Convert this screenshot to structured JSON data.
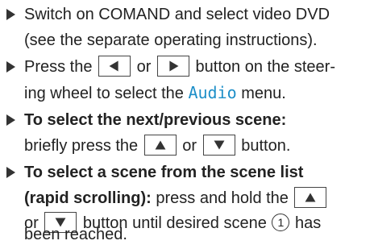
{
  "bullets": [
    {
      "lines": [
        "Switch on COMAND and select video DVD",
        "(see the separate operating instructions)."
      ]
    },
    {
      "l1_a": "Press the",
      "l1_b": "or",
      "l1_c": "button on the steer-",
      "l2_a": "ing wheel to select the",
      "l2_menu": "Audio",
      "l2_b": "menu."
    },
    {
      "l1_bold": "To select the next/previous scene:",
      "l2_a": "briefly press the",
      "l2_b": "or",
      "l2_c": "button."
    },
    {
      "l1_bold": "To select a scene from the scene list",
      "l2_bold": "(rapid scrolling):",
      "l2_a": "press and hold the",
      "l3_a": "or",
      "l3_b": "button until desired scene",
      "l3_marker": "1",
      "l3_c": "has",
      "l4_a": "been reached."
    }
  ],
  "colors": {
    "accent": "#1e8fc8",
    "text": "#222222"
  },
  "icons": [
    "left-arrow-button-icon",
    "right-arrow-button-icon",
    "up-arrow-button-icon",
    "down-arrow-button-icon",
    "bullet-triangle-icon"
  ]
}
